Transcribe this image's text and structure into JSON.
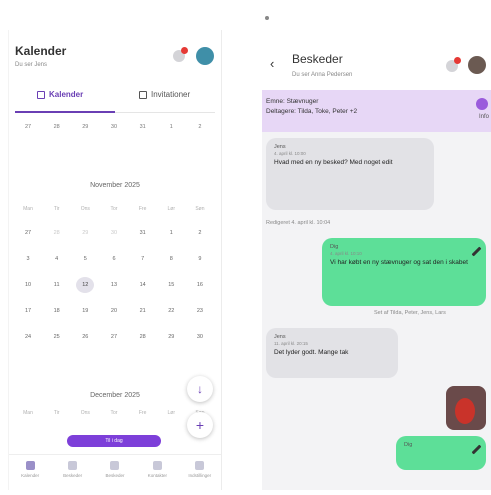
{
  "left": {
    "title": "Kalender",
    "subtitle": "Du ser Jens",
    "tabs": [
      {
        "label": "Kalender",
        "active": true
      },
      {
        "label": "Invitationer",
        "active": false
      }
    ],
    "prev_week": [
      "27",
      "28",
      "29",
      "30",
      "31",
      "1",
      "2"
    ],
    "november": {
      "title": "November 2025",
      "weekdays": [
        "Man",
        "Tir",
        "Ons",
        "Tor",
        "Fre",
        "Lør",
        "Søn"
      ],
      "rows": [
        [
          "27",
          "28",
          "29",
          "30",
          "31",
          "1",
          "2"
        ],
        [
          "3",
          "4",
          "5",
          "6",
          "7",
          "8",
          "9"
        ],
        [
          "10",
          "11",
          "12",
          "13",
          "14",
          "15",
          "16"
        ],
        [
          "17",
          "18",
          "19",
          "20",
          "21",
          "22",
          "23"
        ],
        [
          "24",
          "25",
          "26",
          "27",
          "28",
          "29",
          "30"
        ]
      ]
    },
    "december": {
      "title": "December 2025",
      "weekdays": [
        "Man",
        "Tir",
        "Ons",
        "Tor",
        "Fre",
        "Lør",
        "Søn"
      ]
    },
    "today_button": "Til i dag",
    "fab_down": "↓",
    "fab_add": "+",
    "nav": [
      "Kalender",
      "Beskeder",
      "Beskeder",
      "Kontakter",
      "Indstillinger"
    ]
  },
  "right": {
    "title": "Beskeder",
    "subtitle": "Du ser Anna Pedersen",
    "back": "‹",
    "info_emne": "Emne: Stævnuger",
    "info_deltagere": "Deltagere: Tilda, Toke, Peter +2",
    "info_label": "Info",
    "messages": [
      {
        "sender": "Jens",
        "time": "4. april kl. 10:00",
        "text": "Hvad med en ny besked? Med noget edit",
        "dir": "in"
      },
      {
        "meta": "Redigeret 4. april kl. 10:04"
      },
      {
        "sender": "Dig",
        "time": "4. april kl. 10:10",
        "text": "Vi har købt en ny stævnuger og sat den i skabet",
        "dir": "out"
      },
      {
        "meta": "Set af Tilda, Peter, Jens, Lars"
      },
      {
        "sender": "Jens",
        "time": "11. april kl. 20:15",
        "text": "Det lyder godt. Mange tak",
        "dir": "in"
      },
      {
        "sender": "Dig",
        "time": "",
        "text": "",
        "dir": "out"
      }
    ]
  },
  "colors": {
    "accent": "#6a3fb4",
    "outgoing": "#5ddf98",
    "incoming": "#e2e2e6",
    "info_bar": "#e7d7f6"
  }
}
